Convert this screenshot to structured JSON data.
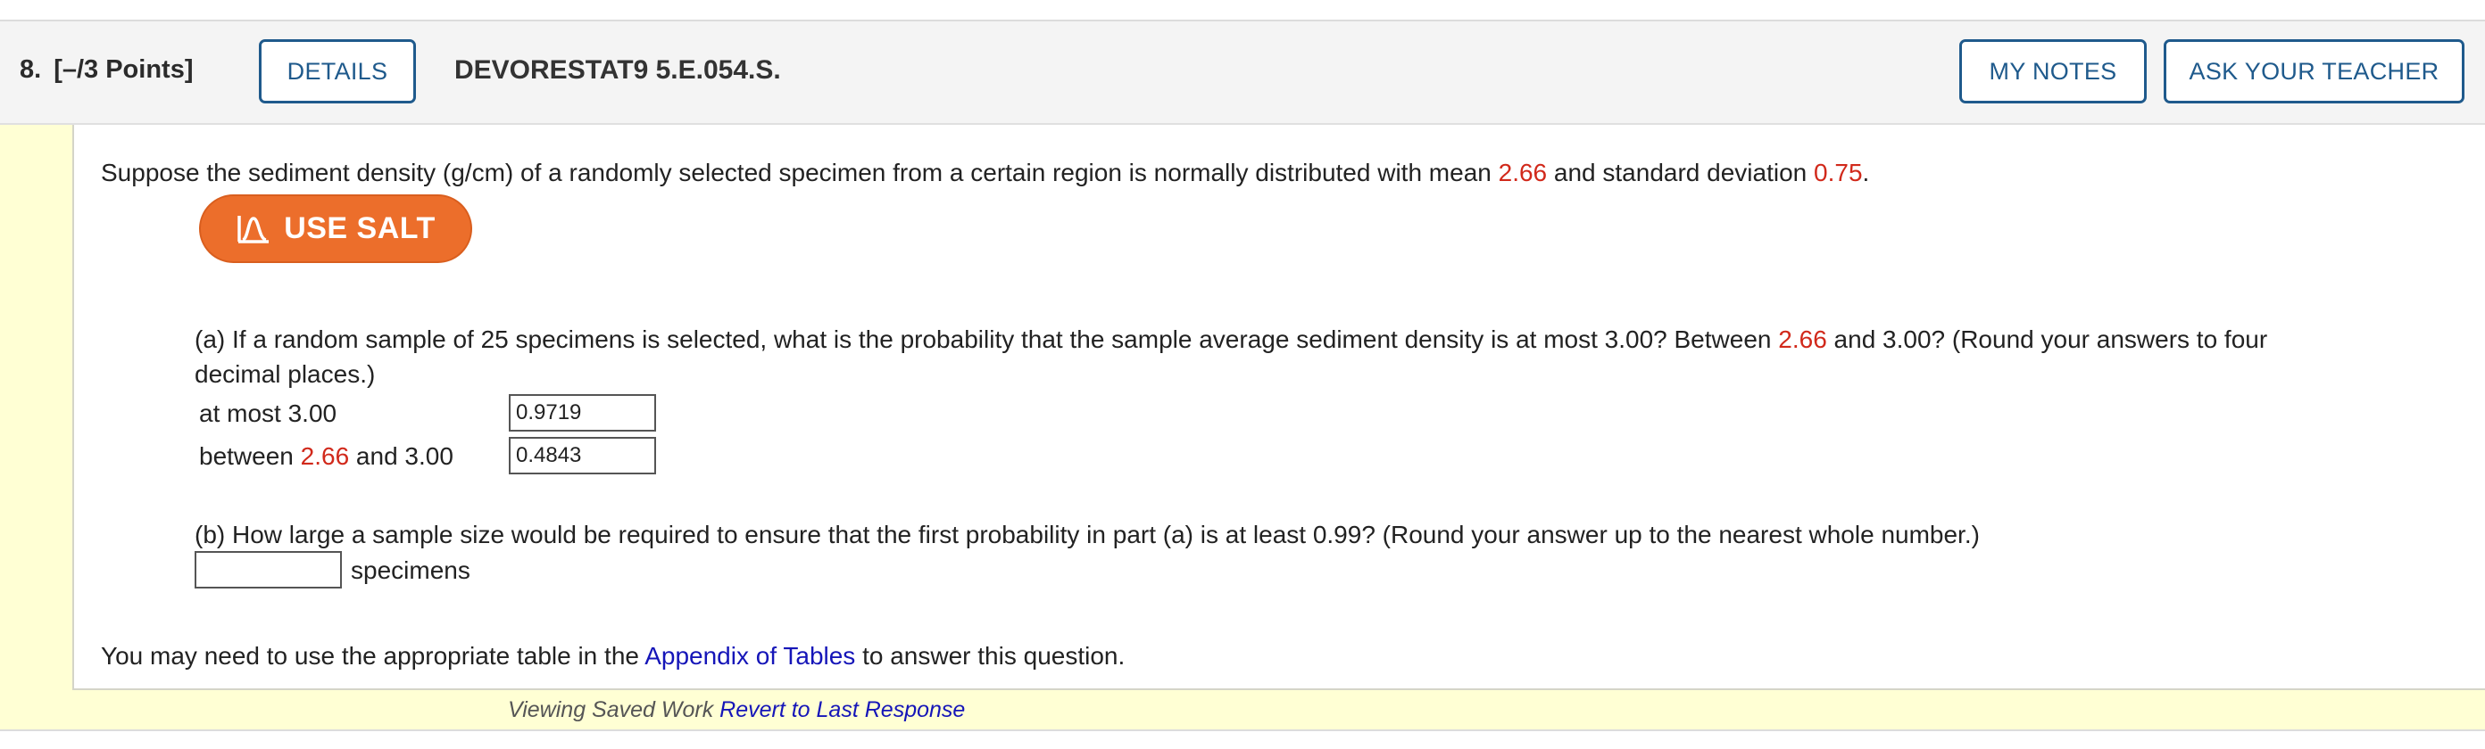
{
  "header": {
    "question_number": "8.",
    "points": "[–/3 Points]",
    "details_label": "DETAILS",
    "assignment_id": "DEVORESTAT9 5.E.054.S.",
    "my_notes_label": "MY NOTES",
    "ask_teacher_label": "ASK YOUR TEACHER"
  },
  "intro": {
    "text_before_mean": "Suppose the sediment density (g/cm) of a randomly selected specimen from a certain region is normally distributed with mean ",
    "mean": "2.66",
    "text_between": " and standard deviation ",
    "sd": "0.75",
    "text_end": "."
  },
  "salt": {
    "label": "USE SALT"
  },
  "part_a": {
    "line1_before": "(a) If a random sample of 25 specimens is selected, what is the probability that the sample average sediment density is at most 3.00? Between ",
    "line1_value": "2.66",
    "line1_after": " and 3.00? (Round your answers to four",
    "line2": "decimal places.)",
    "row1_label": "at most 3.00",
    "row1_value": "0.9719",
    "row2_label_before": "between ",
    "row2_label_value": "2.66",
    "row2_label_after": " and 3.00",
    "row2_value": "0.4843"
  },
  "part_b": {
    "text": "(b) How large a sample size would be required to ensure that the first probability in part (a) is at least 0.99? (Round your answer up to the nearest whole number.)",
    "answer_value": "",
    "unit": "specimens"
  },
  "note": {
    "before": "You may need to use the appropriate table in the ",
    "link": "Appendix of Tables",
    "after": " to answer this question."
  },
  "footer": {
    "status": "Viewing Saved Work",
    "revert_link": "Revert to Last Response"
  },
  "colors": {
    "accent_blue": "#1f5a8c",
    "salt_orange": "#ec6e2b",
    "value_red": "#d1291b",
    "link_blue": "#1515b8",
    "panel_yellow": "#ffffd4"
  }
}
